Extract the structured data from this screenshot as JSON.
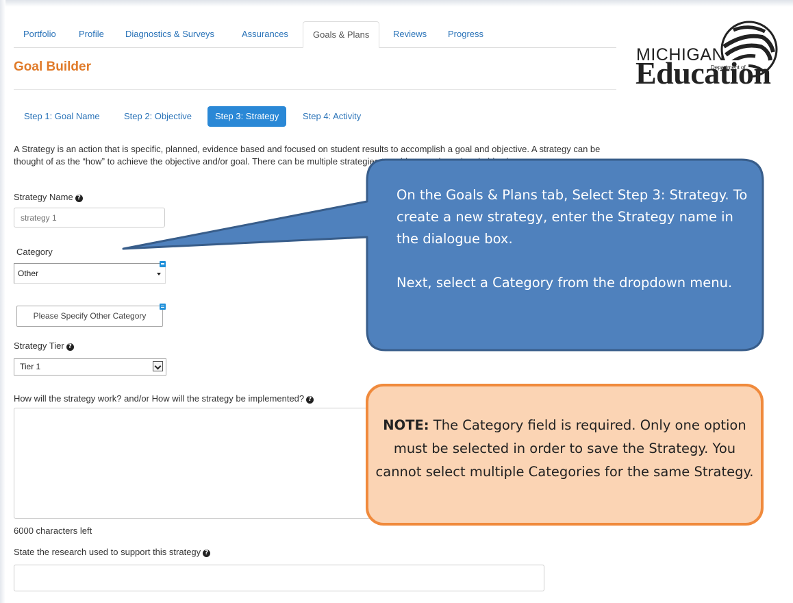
{
  "tabs": [
    {
      "label": "Portfolio",
      "active": false
    },
    {
      "label": "Profile",
      "active": false
    },
    {
      "label": "Diagnostics & Surveys",
      "active": false
    },
    {
      "label": "Assurances",
      "active": false
    },
    {
      "label": "Goals & Plans",
      "active": true
    },
    {
      "label": "Reviews",
      "active": false
    },
    {
      "label": "Progress",
      "active": false
    }
  ],
  "logo": {
    "line1": "MICHIGAN",
    "line2": "Department of",
    "line3": "Education"
  },
  "page_title": "Goal Builder",
  "steps": [
    {
      "label": "Step 1: Goal Name",
      "active": false
    },
    {
      "label": "Step 2: Objective",
      "active": false
    },
    {
      "label": "Step 3: Strategy",
      "active": true
    },
    {
      "label": "Step 4: Activity",
      "active": false
    }
  ],
  "description": "A Strategy is an action that is specific, planned, evidence based and focused on student results to accomplish a goal and objective. A strategy can be thought of as the “how” to achieve the objective and/or goal. There can be multiple strategies to achieve each goal and objective.",
  "form": {
    "strategy_name_label": "Strategy Name",
    "strategy_name_placeholder": "strategy 1",
    "category_label": "Category",
    "category_value": "Other",
    "other_category_button": "Please Specify Other Category",
    "tier_label": "Strategy Tier",
    "tier_value": "Tier 1",
    "how_label": "How will the strategy work? and/or How will the strategy be implemented?",
    "chars_left": "6000 characters left",
    "research_label": "State the research used to support this strategy"
  },
  "callout_blue": {
    "para1": "On the Goals & Plans tab, Select Step 3: Strategy. To create a new strategy, enter the Strategy name in the dialogue box.",
    "para2": "Next, select a Category from the dropdown menu."
  },
  "callout_orange": {
    "lead": "NOTE:",
    "text": " The Category field is required. Only one option must be selected in order to save the Strategy. You cannot select multiple Categories for the same Strategy."
  },
  "colors": {
    "link": "#2a73b8",
    "active_step": "#2a88d6",
    "title_orange": "#e07b2a",
    "callout_blue_fill": "#4f81bd",
    "callout_blue_border": "#385d8a",
    "callout_orange_fill": "#fbd4b4",
    "callout_orange_border": "#f08a3c"
  }
}
